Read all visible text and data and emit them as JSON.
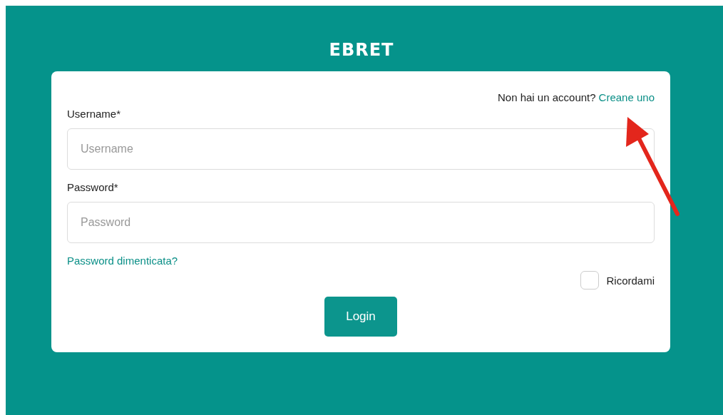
{
  "logo": "EBRET",
  "signup": {
    "prompt": "Non hai un account?",
    "link": "Creane uno"
  },
  "fields": [
    {
      "label": "Username*",
      "placeholder": "Username"
    },
    {
      "label": "Password*",
      "placeholder": "Password"
    }
  ],
  "forgot_link": "Password dimenticata?",
  "remember": {
    "label": "Ricordami",
    "checked": false
  },
  "login_button": "Login"
}
